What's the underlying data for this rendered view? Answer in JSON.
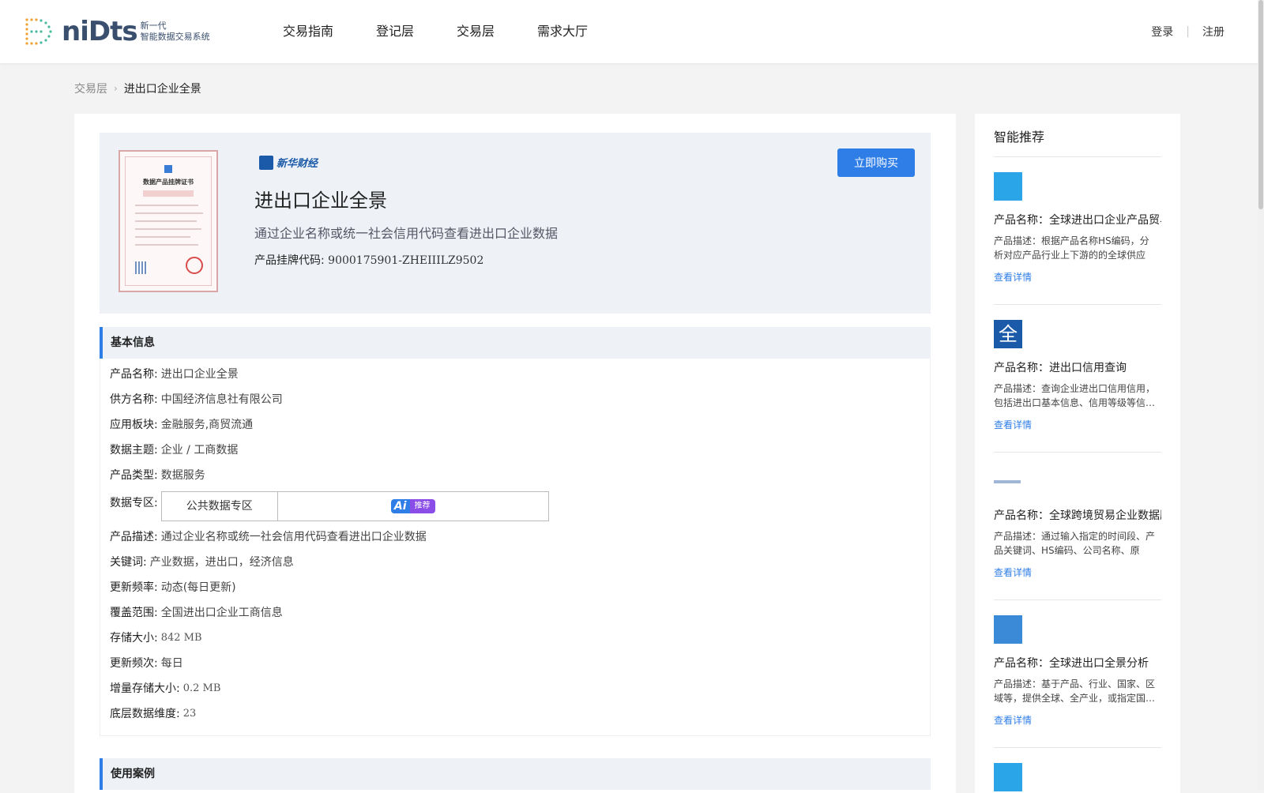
{
  "header": {
    "logo_text": "niDts",
    "logo_sub_line1": "新一代",
    "logo_sub_line2": "智能数据交易系统",
    "nav": [
      "交易指南",
      "登记层",
      "交易层",
      "需求大厅"
    ],
    "login": "登录",
    "separator": "|",
    "register": "注册"
  },
  "breadcrumb": {
    "parent": "交易层",
    "current": "进出口企业全景"
  },
  "product": {
    "cert_title": "数据产品挂牌证书",
    "brand": "新华财经",
    "title": "进出口企业全景",
    "subtitle": "通过企业名称或统一社会信用代码查看进出口企业数据",
    "code_label": "产品挂牌代码:",
    "code_value": "9000175901-ZHEIIILZ9502",
    "buy_label": "立即购买"
  },
  "basic_info": {
    "heading": "基本信息",
    "rows": [
      {
        "k": "产品名称:",
        "v": "进出口企业全景"
      },
      {
        "k": "供方名称:",
        "v": "中国经济信息社有限公司"
      },
      {
        "k": "应用板块:",
        "v": "金融服务,商贸流通"
      },
      {
        "k": "数据主题:",
        "v": "企业 / 工商数据"
      },
      {
        "k": "产品类型:",
        "v": "数据服务"
      }
    ],
    "zone_label": "数据专区:",
    "zone_public": "公共数据专区",
    "ai_badge_a": "Ai",
    "ai_badge_b": "推荐",
    "rows2": [
      {
        "k": "产品描述:",
        "v": "通过企业名称或统一社会信用代码查看进出口企业数据"
      },
      {
        "k": "关键词:",
        "v": "产业数据，进出口，经济信息"
      },
      {
        "k": "更新频率:",
        "v": "动态(每日更新)"
      },
      {
        "k": "覆盖范围:",
        "v": "全国进出口企业工商信息"
      },
      {
        "k": "存储大小:",
        "v": "842 MB"
      },
      {
        "k": "更新频次:",
        "v": "每日"
      },
      {
        "k": "增量存储大小:",
        "v": "0.2 MB"
      },
      {
        "k": "底层数据维度:",
        "v": "23"
      }
    ]
  },
  "use_case": {
    "heading": "使用案例"
  },
  "sidebar": {
    "title": "智能推荐",
    "items": [
      {
        "name": "产品名称：全球进出口企业产品贸易",
        "desc": "产品描述：根据产品名称HS编码，分析对应产品行业上下游的的全球供应链…",
        "link": "查看详情",
        "thumb_color": "#2aa6e8"
      },
      {
        "name": "产品名称：进出口信用查询",
        "desc": "产品描述：查询企业进出口信用信用，包括进出口基本信息、信用等级等信…",
        "link": "查看详情",
        "thumb_color": "#1a5aa8"
      },
      {
        "name": "产品名称：全球跨境贸易企业数据服务",
        "desc": "产品描述：通过输入指定的时间段、产品关键词、HS编码、公司名称、原产…",
        "link": "查看详情",
        "thumb_color": "#e8f0fb"
      },
      {
        "name": "产品名称：全球进出口全景分析",
        "desc": "产品描述：基于产品、行业、国家、区域等，提供全球、全产业，或指定国…",
        "link": "查看详情",
        "thumb_color": "#3a8ad8"
      }
    ]
  }
}
